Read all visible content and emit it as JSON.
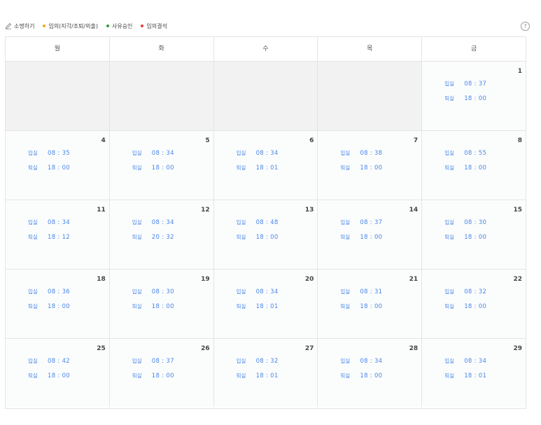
{
  "toolbar": {
    "explain_label": "소명하기",
    "legends": [
      {
        "label": "임의(지각/조퇴/외출)",
        "color": "#f5a623"
      },
      {
        "label": "사유승인",
        "color": "#2e9e3a"
      },
      {
        "label": "임의결석",
        "color": "#e53935"
      }
    ],
    "help_label": "?"
  },
  "weekdays": [
    "월",
    "화",
    "수",
    "목",
    "금"
  ],
  "labels": {
    "in": "입실",
    "out": "퇴실"
  },
  "weeks": [
    [
      null,
      null,
      null,
      null,
      {
        "date": "1",
        "in": "08 : 37",
        "out": "18 : 00"
      }
    ],
    [
      {
        "date": "4",
        "in": "08 : 35",
        "out": "18 : 00"
      },
      {
        "date": "5",
        "in": "08 : 34",
        "out": "18 : 00"
      },
      {
        "date": "6",
        "in": "08 : 34",
        "out": "18 : 01"
      },
      {
        "date": "7",
        "in": "08 : 38",
        "out": "18 : 00"
      },
      {
        "date": "8",
        "in": "08 : 55",
        "out": "18 : 00"
      }
    ],
    [
      {
        "date": "11",
        "in": "08 : 34",
        "out": "18 : 12"
      },
      {
        "date": "12",
        "in": "08 : 34",
        "out": "20 : 32"
      },
      {
        "date": "13",
        "in": "08 : 48",
        "out": "18 : 00"
      },
      {
        "date": "14",
        "in": "08 : 37",
        "out": "18 : 00"
      },
      {
        "date": "15",
        "in": "08 : 30",
        "out": "18 : 00"
      }
    ],
    [
      {
        "date": "18",
        "in": "08 : 36",
        "out": "18 : 00"
      },
      {
        "date": "19",
        "in": "08 : 30",
        "out": "18 : 00"
      },
      {
        "date": "20",
        "in": "08 : 34",
        "out": "18 : 01"
      },
      {
        "date": "21",
        "in": "08 : 31",
        "out": "18 : 00"
      },
      {
        "date": "22",
        "in": "08 : 32",
        "out": "18 : 00"
      }
    ],
    [
      {
        "date": "25",
        "in": "08 : 42",
        "out": "18 : 00"
      },
      {
        "date": "26",
        "in": "08 : 37",
        "out": "18 : 00"
      },
      {
        "date": "27",
        "in": "08 : 32",
        "out": "18 : 01"
      },
      {
        "date": "28",
        "in": "08 : 34",
        "out": "18 : 00"
      },
      {
        "date": "29",
        "in": "08 : 34",
        "out": "18 : 01"
      }
    ]
  ]
}
